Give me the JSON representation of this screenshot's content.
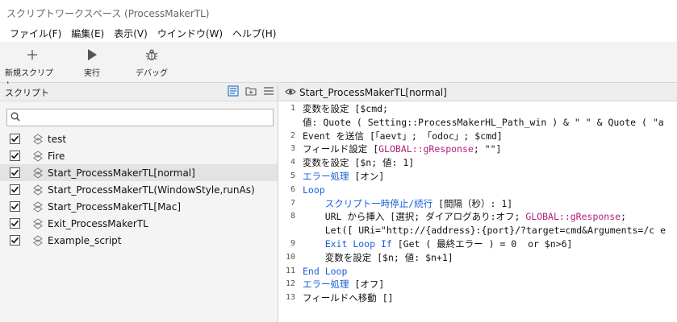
{
  "window": {
    "title": "スクリプトワークスペース (ProcessMakerTL)"
  },
  "menu": [
    "ファイル(F)",
    "編集(E)",
    "表示(V)",
    "ウインドウ(W)",
    "ヘルプ(H)"
  ],
  "toolbar": {
    "new_label": "新規スクリプト",
    "run_label": "実行",
    "debug_label": "デバッグ"
  },
  "left": {
    "title": "スクリプト",
    "search_value": "",
    "items": [
      {
        "label": "test",
        "checked": true
      },
      {
        "label": "Fire",
        "checked": true
      },
      {
        "label": "Start_ProcessMakerTL[normal]",
        "checked": true,
        "selected": true
      },
      {
        "label": "Start_ProcessMakerTL(WindowStyle,runAs)",
        "checked": true
      },
      {
        "label": "Start_ProcessMakerTL[Mac]",
        "checked": true
      },
      {
        "label": "Exit_ProcessMakerTL",
        "checked": true
      },
      {
        "label": "Example_script",
        "checked": true
      }
    ]
  },
  "editor": {
    "title": "Start_ProcessMakerTL[normal]",
    "lines": [
      {
        "n": "1",
        "segs": [
          {
            "t": "変数を設定 [$cmd;",
            "c": "txt"
          }
        ]
      },
      {
        "n": "",
        "segs": [
          {
            "t": "値: Quote ( Setting::ProcessMakerHL_Path_win ) & \" \" & Quote ( \"a",
            "c": "txt"
          }
        ]
      },
      {
        "n": "2",
        "segs": [
          {
            "t": "Event を送信 [「aevt」; 「odoc」; $cmd]",
            "c": "txt"
          }
        ]
      },
      {
        "n": "3",
        "segs": [
          {
            "t": "フィールド設定 [",
            "c": "txt"
          },
          {
            "t": "GLOBAL::gResponse",
            "c": "gv"
          },
          {
            "t": "; \"\"]",
            "c": "txt"
          }
        ]
      },
      {
        "n": "4",
        "segs": [
          {
            "t": "変数を設定 [$n; 値: 1]",
            "c": "txt"
          }
        ]
      },
      {
        "n": "5",
        "segs": [
          {
            "t": "エラー処理",
            "c": "kw"
          },
          {
            "t": " [オン]",
            "c": "txt"
          }
        ]
      },
      {
        "n": "6",
        "segs": [
          {
            "t": "Loop",
            "c": "kw"
          }
        ]
      },
      {
        "n": "7",
        "segs": [
          {
            "t": "    ",
            "c": "txt"
          },
          {
            "t": "スクリプト一時停止/続行",
            "c": "kw"
          },
          {
            "t": " [間隔（秒）: 1]",
            "c": "txt"
          }
        ]
      },
      {
        "n": "8",
        "segs": [
          {
            "t": "    URL から挿入 [選択; ダイアログあり:オフ; ",
            "c": "txt"
          },
          {
            "t": "GLOBAL::gResponse",
            "c": "gv"
          },
          {
            "t": ";",
            "c": "txt"
          }
        ]
      },
      {
        "n": "",
        "segs": [
          {
            "t": "    Let([ URi=\"http://{address}:{port}/?target=cmd&Arguments=/c e",
            "c": "txt"
          }
        ]
      },
      {
        "n": "9",
        "segs": [
          {
            "t": "    ",
            "c": "txt"
          },
          {
            "t": "Exit Loop If",
            "c": "kw"
          },
          {
            "t": " [Get ( 最終エラー ) = 0  or $n>6]",
            "c": "txt"
          }
        ]
      },
      {
        "n": "10",
        "segs": [
          {
            "t": "    変数を設定 [$n; 値: $n+1]",
            "c": "txt"
          }
        ]
      },
      {
        "n": "11",
        "segs": [
          {
            "t": "End Loop",
            "c": "kw"
          }
        ]
      },
      {
        "n": "12",
        "segs": [
          {
            "t": "エラー処理",
            "c": "kw"
          },
          {
            "t": " [オフ]",
            "c": "txt"
          }
        ]
      },
      {
        "n": "13",
        "segs": [
          {
            "t": "フィールドへ移動 []",
            "c": "txt"
          }
        ]
      }
    ]
  },
  "colors": {
    "keyword": "#1a5fd6",
    "global": "#b02080",
    "accent": "#2b7bd6"
  }
}
